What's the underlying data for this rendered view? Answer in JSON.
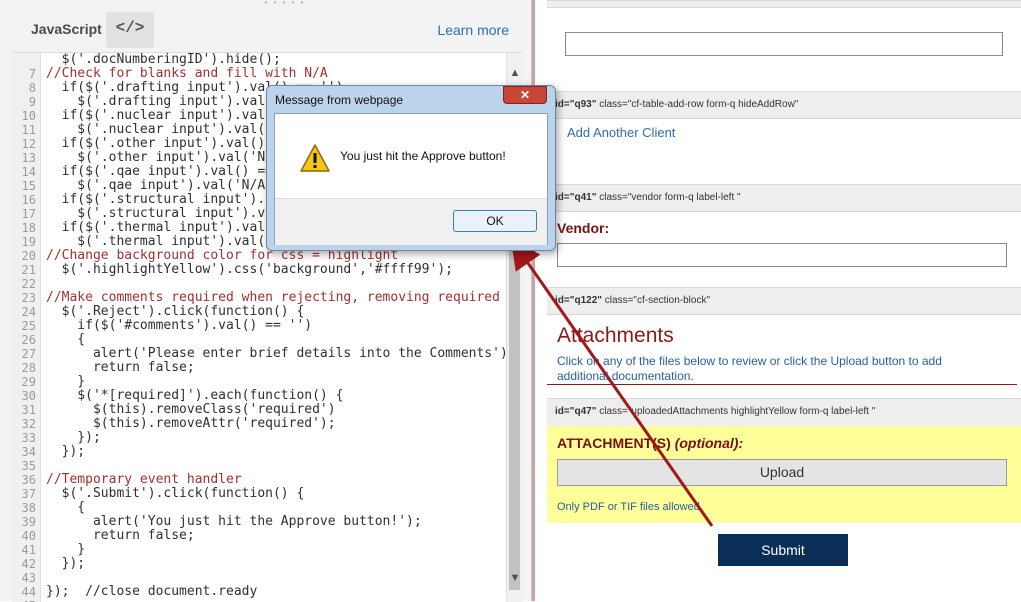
{
  "editor": {
    "language": "JavaScript",
    "toggle_label": "</>",
    "learn_more": "Learn more",
    "lines": [
      {
        "n": "",
        "t": "  $('.docNumberingID').hide();",
        "c": "plain"
      },
      {
        "n": "7",
        "t": "//Check for blanks and fill with N/A",
        "c": "cmt"
      },
      {
        "n": "8",
        "t": "  if($('.drafting input').val() == '')",
        "c": "plain"
      },
      {
        "n": "9",
        "t": "    $('.drafting input').val('N/A');",
        "c": "plain"
      },
      {
        "n": "10",
        "t": "  if($('.nuclear input').val() == '')",
        "c": "plain"
      },
      {
        "n": "11",
        "t": "    $('.nuclear input').val('N/A');",
        "c": "plain"
      },
      {
        "n": "12",
        "t": "  if($('.other input').val() == '')",
        "c": "plain"
      },
      {
        "n": "13",
        "t": "    $('.other input').val('N/A');",
        "c": "plain"
      },
      {
        "n": "14",
        "t": "  if($('.qae input').val() == '')",
        "c": "plain"
      },
      {
        "n": "15",
        "t": "    $('.qae input').val('N/A');",
        "c": "plain"
      },
      {
        "n": "16",
        "t": "  if($('.structural input').val() == '')",
        "c": "plain"
      },
      {
        "n": "17",
        "t": "    $('.structural input').val('N/A');",
        "c": "plain"
      },
      {
        "n": "18",
        "t": "  if($('.thermal input').val() == '')",
        "c": "plain"
      },
      {
        "n": "19",
        "t": "    $('.thermal input').val('N/A');",
        "c": "plain"
      },
      {
        "n": "20",
        "t": "//Change background color for css = highlight",
        "c": "cmt"
      },
      {
        "n": "21",
        "t": "  $('.highlightYellow').css('background','#ffff99');",
        "c": "plain"
      },
      {
        "n": "22",
        "t": "",
        "c": "plain"
      },
      {
        "n": "23",
        "t": "//Make comments required when rejecting, removing required",
        "c": "cmt"
      },
      {
        "n": "24",
        "t": "  $('.Reject').click(function() {",
        "c": "plain"
      },
      {
        "n": "25",
        "t": "    if($('#comments').val() == '')",
        "c": "plain"
      },
      {
        "n": "26",
        "t": "    {",
        "c": "plain"
      },
      {
        "n": "27",
        "t": "      alert('Please enter brief details into the Comments');",
        "c": "plain"
      },
      {
        "n": "28",
        "t": "      return false;",
        "c": "plain"
      },
      {
        "n": "29",
        "t": "    }",
        "c": "plain"
      },
      {
        "n": "30",
        "t": "    $('*[required]').each(function() {",
        "c": "plain"
      },
      {
        "n": "31",
        "t": "      $(this).removeClass('required')",
        "c": "plain"
      },
      {
        "n": "32",
        "t": "      $(this).removeAttr('required');",
        "c": "plain"
      },
      {
        "n": "33",
        "t": "    });",
        "c": "plain"
      },
      {
        "n": "34",
        "t": "  });",
        "c": "plain"
      },
      {
        "n": "35",
        "t": "",
        "c": "plain"
      },
      {
        "n": "36",
        "t": "//Temporary event handler",
        "c": "cmt"
      },
      {
        "n": "37",
        "t": "  $('.Submit').click(function() {",
        "c": "plain"
      },
      {
        "n": "38",
        "t": "    {",
        "c": "plain"
      },
      {
        "n": "39",
        "t": "      alert('You just hit the Approve button!');",
        "c": "plain"
      },
      {
        "n": "40",
        "t": "      return false;",
        "c": "plain"
      },
      {
        "n": "41",
        "t": "    }",
        "c": "plain"
      },
      {
        "n": "42",
        "t": "  });",
        "c": "plain"
      },
      {
        "n": "43",
        "t": "",
        "c": "plain"
      },
      {
        "n": "44",
        "t": "});  //close document.ready",
        "c": "mixed"
      },
      {
        "n": "45",
        "t": "",
        "c": "plain"
      }
    ]
  },
  "form": {
    "q93_id": "id=\"q93\"",
    "q93_class": "class=\"cf-table-add-row form-q hideAddRow\"",
    "add_client": "Add Another Client",
    "q41_id": "id=\"q41\"",
    "q41_class": "class=\"vendor form-q label-left \"",
    "vendor_label": "Vendor:",
    "q122_id": "id=\"q122\"",
    "q122_class": "class=\"cf-section-block\"",
    "attach_title": "Attachments",
    "attach_desc": "Click on any of the files below to review or click the Upload button to add additional documentation.",
    "q47_id": "id=\"q47\"",
    "q47_class": "class=\"uploadedAttachments highlightYellow form-q label-left \"",
    "attach_label": "ATTACHMENT(S)",
    "attach_optional": "(optional):",
    "upload": "Upload",
    "file_note": "Only PDF or TIF files allowed.",
    "submit": "Submit"
  },
  "dialog": {
    "title": "Message from webpage",
    "close": "✕",
    "message": "You just hit the Approve button!",
    "ok": "OK"
  },
  "colors": {
    "arrow": "#a01818",
    "submit_bg": "#0b2e56",
    "highlight": "#ffff99"
  }
}
